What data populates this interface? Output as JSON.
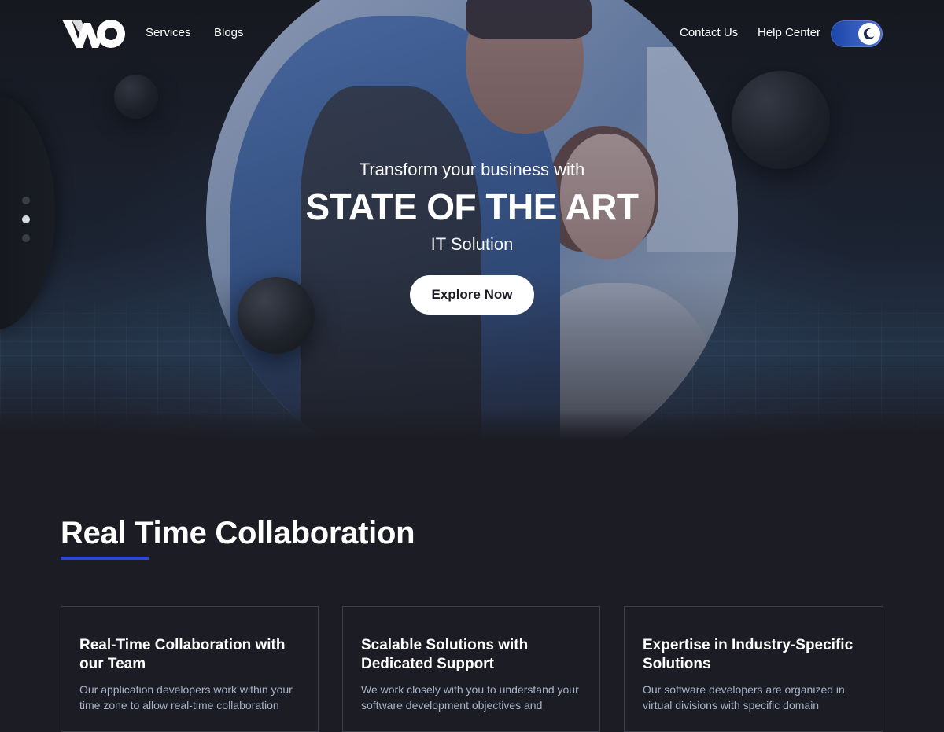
{
  "nav": {
    "logo_text": "WO",
    "links_left": [
      "Services",
      "Blogs"
    ],
    "links_right": [
      "Contact Us",
      "Help Center"
    ],
    "theme_toggle": {
      "mode": "dark",
      "icon": "moon-icon",
      "accent": "#2c4fc0"
    }
  },
  "hero": {
    "line1": "Transform your business with",
    "line2": "STATE OF THE ART",
    "line3": "IT Solution",
    "cta_label": "Explore Now",
    "slider": {
      "count": 3,
      "active_index": 1
    }
  },
  "section": {
    "title": "Real Time Collaboration",
    "underline_color": "#2c46d6"
  },
  "cards": [
    {
      "title": "Real-Time Collaboration with our Team",
      "text": "Our application developers work within your time zone to allow real-time collaboration"
    },
    {
      "title": "Scalable Solutions with Dedicated Support",
      "text": "We work closely with you to understand your software development objectives and"
    },
    {
      "title": "Expertise in Industry-Specific Solutions",
      "text": "Our software developers are organized in virtual divisions with specific domain"
    }
  ],
  "colors": {
    "background": "#1c1c24",
    "card_border": "#3b3d48",
    "body_text": "#a9b3c8",
    "button_bg": "#ffffff"
  }
}
